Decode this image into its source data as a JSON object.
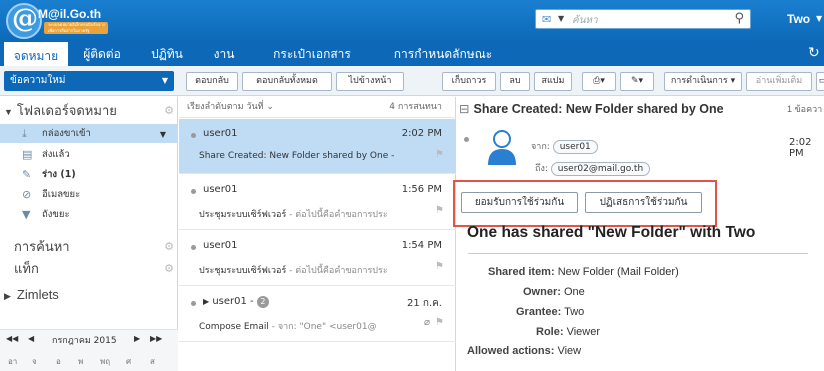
{
  "header": {
    "logo_text": "M@il.Go.th",
    "logo_subtext": "ระบบจดหมายอิเล็กทรอนิกส์กลางเพื่อการสื่อสารในภาครัฐ",
    "search_placeholder": "ค้นหา",
    "user_name": "Two"
  },
  "apps": [
    "จดหมาย",
    "ผู้ติดต่อ",
    "ปฏิทิน",
    "งาน",
    "กระเป๋าเอกสาร",
    "การกำหนดลักษณะ"
  ],
  "toolbar": {
    "new_message": "ข้อความใหม่",
    "reply": "ตอบกลับ",
    "reply_all": "ตอบกลับทั้งหมด",
    "forward": "ไปข้างหน้า",
    "archive": "เก็บถาวร",
    "delete": "ลบ",
    "spam": "สแปม",
    "actions": "การดำเนินการ",
    "read_more": "อ่านเพิ่มเติม"
  },
  "sidebar": {
    "folders_header": "โฟลเดอร์จดหมาย",
    "folders": [
      {
        "label": "กล่องขาเข้า",
        "icon": "inbox-icon"
      },
      {
        "label": "ส่งแล้ว",
        "icon": "sent-icon"
      },
      {
        "label": "ร่าง (1)",
        "icon": "drafts-icon"
      },
      {
        "label": "อีเมลขยะ",
        "icon": "junk-icon"
      },
      {
        "label": "ถังขยะ",
        "icon": "trash-icon"
      }
    ],
    "search_header": "การค้นหา",
    "tags_header": "แท็ก",
    "zimlets_header": "Zimlets",
    "calendar_month": "กรกฎาคม 2015",
    "calendar_days": [
      "อา",
      "จ",
      "อ",
      "พ",
      "พฤ",
      "ศ",
      "ส"
    ]
  },
  "list": {
    "sort_label": "เรียงลำดับตาม วันที่",
    "count": "4 การสนทนา",
    "messages": [
      {
        "from": "user01",
        "time": "2:02 PM",
        "subject": "Share Created: New Folder shared by One -",
        "fragment": ""
      },
      {
        "from": "user01",
        "time": "1:56 PM",
        "subject": "ประชุมระบบเซิร์ฟเวอร์",
        "fragment": " - ต่อไปนี้คือคำขอการประ"
      },
      {
        "from": "user01",
        "time": "1:54 PM",
        "subject": "ประชุมระบบเซิร์ฟเวอร์",
        "fragment": " - ต่อไปนี้คือคำขอการประ"
      },
      {
        "from": "user01 -",
        "badge": "2",
        "time": "21 ก.ค.",
        "subject": "Compose Email",
        "fragment": " - จาก: \"One\" <user01@"
      }
    ]
  },
  "reading": {
    "title": "Share Created: New Folder shared by One",
    "count": "1 ข้อควา",
    "from_label": "จาก:",
    "from": "user01",
    "to_label": "ถึง:",
    "to": "user02@mail.go.th",
    "time": "2:02 PM",
    "accept_button": "ยอมรับการใช้ร่วมกัน",
    "decline_button": "ปฏิเสธการใช้ร่วมกัน",
    "headline": "One has shared \"New Folder\" with Two",
    "details": [
      {
        "label": "Shared item:",
        "value": "New Folder (Mail Folder)"
      },
      {
        "label": "Owner:",
        "value": "One"
      },
      {
        "label": "Grantee:",
        "value": "Two"
      },
      {
        "label": "Role:",
        "value": "Viewer"
      },
      {
        "label": "Allowed actions:",
        "value": "View"
      }
    ]
  }
}
